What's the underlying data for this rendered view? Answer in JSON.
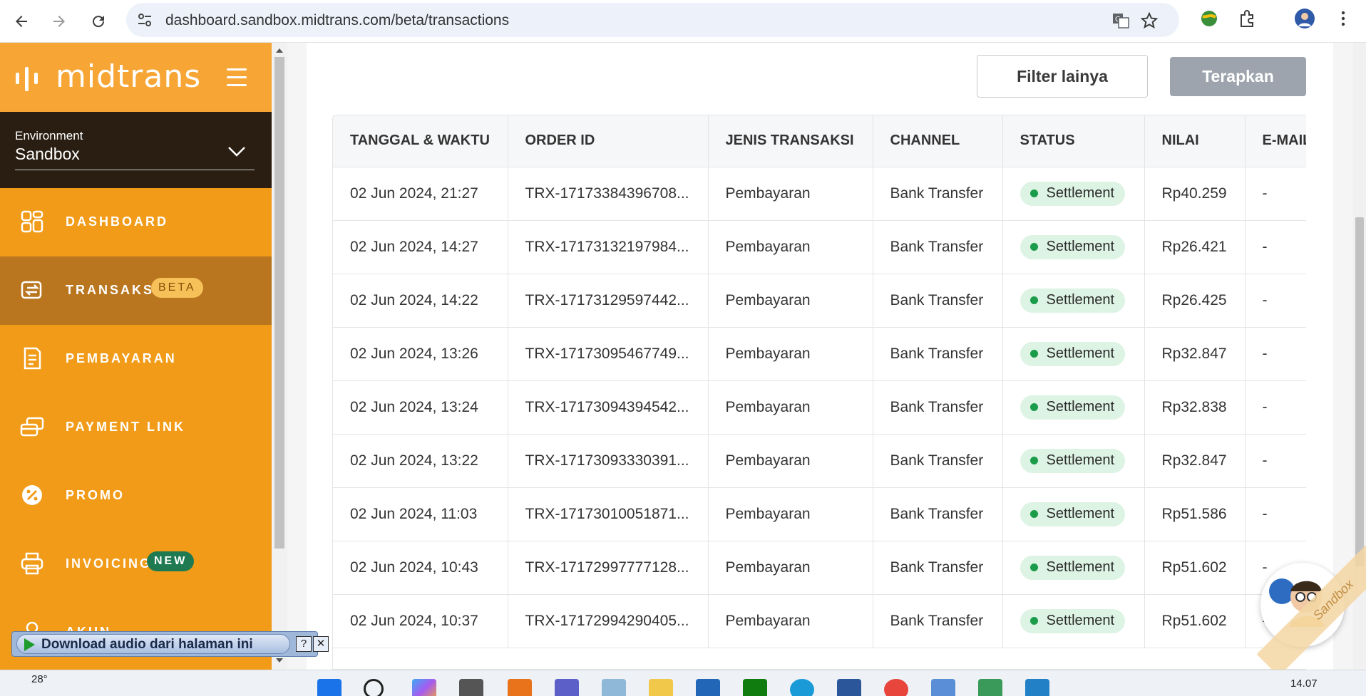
{
  "browser": {
    "url": "dashboard.sandbox.midtrans.com/beta/transactions"
  },
  "sidebar": {
    "brand": "midtrans",
    "environment": {
      "label": "Environment",
      "value": "Sandbox"
    },
    "items": [
      {
        "label": "DASHBOARD",
        "icon": "dashboard-icon"
      },
      {
        "label": "TRANSAKSI",
        "icon": "transaction-icon",
        "badge": "BETA",
        "active": true
      },
      {
        "label": "PEMBAYARAN",
        "icon": "receipt-icon"
      },
      {
        "label": "PAYMENT LINK",
        "icon": "payment-link-icon"
      },
      {
        "label": "PROMO",
        "icon": "promo-icon"
      },
      {
        "label": "INVOICING",
        "icon": "invoice-icon",
        "badge": "NEW"
      },
      {
        "label": "AKUN",
        "icon": "user-icon"
      }
    ]
  },
  "toolbar": {
    "filter_label": "Filter lainya",
    "apply_label": "Terapkan"
  },
  "table": {
    "headers": [
      "TANGGAL & WAKTU",
      "ORDER ID",
      "JENIS TRANSAKSI",
      "CHANNEL",
      "STATUS",
      "NILAI",
      "E-MAIL"
    ],
    "rows": [
      {
        "date": "02 Jun 2024, 21:27",
        "order_id": "TRX-17173384396708...",
        "type": "Pembayaran",
        "channel": "Bank Transfer",
        "status": "Settlement",
        "amount": "Rp40.259",
        "email": "-"
      },
      {
        "date": "02 Jun 2024, 14:27",
        "order_id": "TRX-17173132197984...",
        "type": "Pembayaran",
        "channel": "Bank Transfer",
        "status": "Settlement",
        "amount": "Rp26.421",
        "email": "-"
      },
      {
        "date": "02 Jun 2024, 14:22",
        "order_id": "TRX-17173129597442...",
        "type": "Pembayaran",
        "channel": "Bank Transfer",
        "status": "Settlement",
        "amount": "Rp26.425",
        "email": "-"
      },
      {
        "date": "02 Jun 2024, 13:26",
        "order_id": "TRX-17173095467749...",
        "type": "Pembayaran",
        "channel": "Bank Transfer",
        "status": "Settlement",
        "amount": "Rp32.847",
        "email": "-"
      },
      {
        "date": "02 Jun 2024, 13:24",
        "order_id": "TRX-17173094394542...",
        "type": "Pembayaran",
        "channel": "Bank Transfer",
        "status": "Settlement",
        "amount": "Rp32.838",
        "email": "-"
      },
      {
        "date": "02 Jun 2024, 13:22",
        "order_id": "TRX-17173093330391...",
        "type": "Pembayaran",
        "channel": "Bank Transfer",
        "status": "Settlement",
        "amount": "Rp32.847",
        "email": "-"
      },
      {
        "date": "02 Jun 2024, 11:03",
        "order_id": "TRX-17173010051871...",
        "type": "Pembayaran",
        "channel": "Bank Transfer",
        "status": "Settlement",
        "amount": "Rp51.586",
        "email": "-"
      },
      {
        "date": "02 Jun 2024, 10:43",
        "order_id": "TRX-17172997777128...",
        "type": "Pembayaran",
        "channel": "Bank Transfer",
        "status": "Settlement",
        "amount": "Rp51.602",
        "email": "-"
      },
      {
        "date": "02 Jun 2024, 10:37",
        "order_id": "TRX-17172994290405...",
        "type": "Pembayaran",
        "channel": "Bank Transfer",
        "status": "Settlement",
        "amount": "Rp51.602",
        "email": "-"
      }
    ]
  },
  "widgets": {
    "ribbon": "Sandbox",
    "download_label": "Download audio dari halaman ini",
    "help_label": "?",
    "close_label": "✕"
  },
  "taskbar": {
    "temperature": "28°",
    "time": "14.07"
  },
  "colors": {
    "sidebar": "#f19b18",
    "sidebar_active": "#b9761f",
    "settlement_bg": "#ddf3e4",
    "settlement_dot": "#1a9c4a"
  }
}
